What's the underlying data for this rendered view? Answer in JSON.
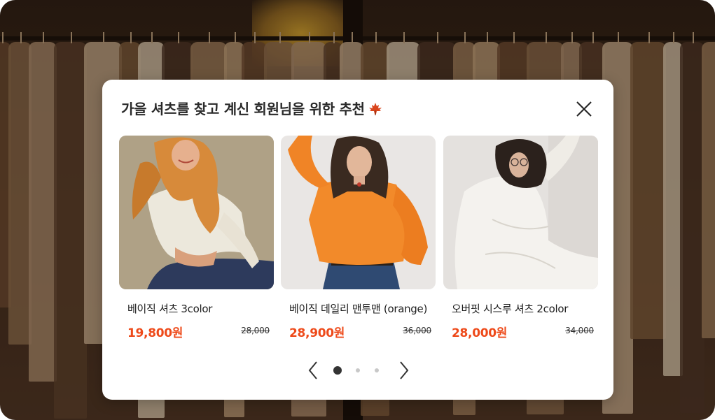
{
  "background": {
    "description_icon": "clothing-rack-photo"
  },
  "modal": {
    "title": "가을 셔츠를 찾고 계신 회원님을 위한 추천",
    "title_icon": "maple-leaf-icon",
    "close_icon": "close-icon",
    "accent_color": "#ee4a1a",
    "products": [
      {
        "name": "베이직 셔츠 3color",
        "price": "19,800원",
        "original_price": "28,000",
        "image": "woman-white-shirt-photo"
      },
      {
        "name": "베이직 데일리 맨투맨 (orange)",
        "price": "28,900원",
        "original_price": "36,000",
        "image": "woman-orange-sweatshirt-photo"
      },
      {
        "name": "오버핏 시스루 셔츠 2color",
        "price": "28,000원",
        "original_price": "34,000",
        "image": "woman-sheer-white-shirt-photo"
      }
    ],
    "pagination": {
      "prev_icon": "chevron-left-icon",
      "next_icon": "chevron-right-icon",
      "page_count": 3,
      "current_page": 1
    }
  }
}
